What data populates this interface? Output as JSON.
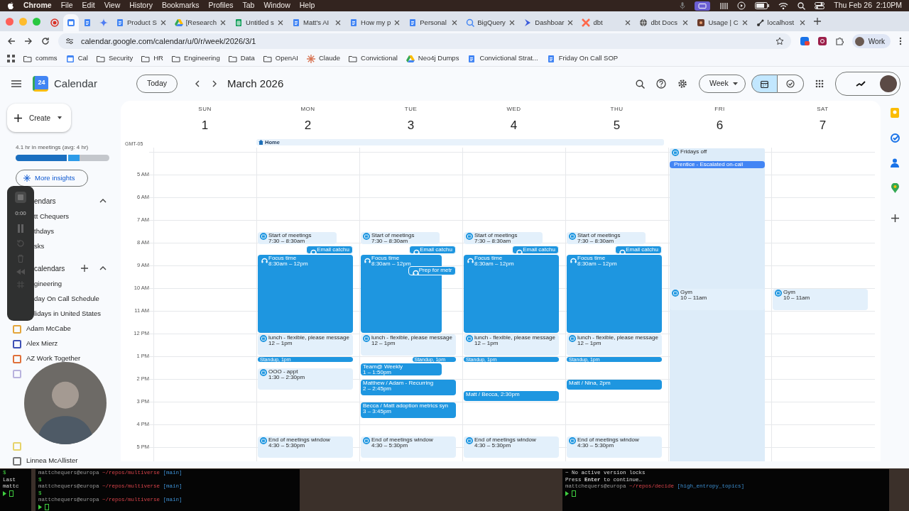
{
  "menu_bar": {
    "menus": [
      "Chrome",
      "File",
      "Edit",
      "View",
      "History",
      "Bookmarks",
      "Profiles",
      "Tab",
      "Window",
      "Help"
    ],
    "clock": "Thu Feb 26  2:10PM"
  },
  "browser": {
    "tabs": [
      {
        "kind": "record",
        "selected": false
      },
      {
        "kind": "calendar",
        "selected": true
      },
      {
        "kind": "docs",
        "selected": false
      },
      {
        "kind": "gemini",
        "selected": false
      },
      {
        "kind": "docs",
        "title": "Product S",
        "selected": false
      },
      {
        "kind": "drive",
        "title": "[Research",
        "selected": false
      },
      {
        "kind": "sheets",
        "title": "Untitled s",
        "selected": false
      },
      {
        "kind": "docs",
        "title": "Matt's AI",
        "selected": false
      },
      {
        "kind": "docs",
        "title": "How my p",
        "selected": false
      },
      {
        "kind": "docs",
        "title": "Personal",
        "selected": false
      },
      {
        "kind": "bigquery",
        "title": "BigQuery",
        "selected": false
      },
      {
        "kind": "dashboard",
        "title": "Dashboar",
        "selected": false
      },
      {
        "kind": "dbt",
        "title": "dbt",
        "selected": false
      },
      {
        "kind": "globe",
        "title": "dbt Docs",
        "selected": false
      },
      {
        "kind": "usage",
        "title": "Usage | C",
        "selected": false
      },
      {
        "kind": "localhost",
        "title": "localhost",
        "selected": false
      }
    ],
    "url": "calendar.google.com/calendar/u/0/r/week/2026/3/1",
    "profile": "Work",
    "bookmarks": [
      {
        "kind": "folder",
        "label": "comms"
      },
      {
        "kind": "cal",
        "label": "Cal"
      },
      {
        "kind": "folder",
        "label": "Security"
      },
      {
        "kind": "folder",
        "label": "HR"
      },
      {
        "kind": "folder",
        "label": "Engineering"
      },
      {
        "kind": "folder",
        "label": "Data"
      },
      {
        "kind": "folder",
        "label": "OpenAI"
      },
      {
        "kind": "claude",
        "label": "Claude"
      },
      {
        "kind": "folder",
        "label": "Convictional"
      },
      {
        "kind": "drive",
        "label": "Neo4j Dumps"
      },
      {
        "kind": "docs",
        "label": "Convictional Strat..."
      },
      {
        "kind": "docs",
        "label": "Friday On Call SOP"
      }
    ]
  },
  "calendar": {
    "logo_text": "24",
    "app_name": "Calendar",
    "today": "Today",
    "month": "March 2026",
    "view": "Week",
    "task_view_selected": false,
    "sidebar": {
      "create": "Create",
      "insight_text": "4.1 hr in meetings (avg: 4 hr)",
      "insight_bar": {
        "level": 0.68
      },
      "insights_button": "More insights",
      "sections": [
        {
          "title": "endars",
          "expanded": true,
          "add": false,
          "items": [
            {
              "kind": "cut",
              "label": "tt Chequers"
            },
            {
              "kind": "cut",
              "label": "thdays"
            },
            {
              "kind": "cut",
              "label": "sks"
            }
          ]
        },
        {
          "title": "calendars",
          "expanded": true,
          "add": true,
          "items": [
            {
              "kind": "cut",
              "label": "gineering"
            },
            {
              "kind": "cut",
              "label": "day On Call Schedule"
            },
            {
              "kind": "cut",
              "label": "lidays in United States"
            },
            {
              "kind": "calendar",
              "label": "Adam McCabe",
              "checked": false,
              "color": "#e4a53a"
            },
            {
              "kind": "calendar",
              "label": "Alex Mierz",
              "checked": false,
              "color": "#3f51b5"
            },
            {
              "kind": "calendar",
              "label": "AZ Work Together",
              "checked": false,
              "color": "#e0703a"
            },
            {
              "kind": "calendar",
              "checked": false,
              "color": "#b9b3de"
            },
            {
              "kind": "calendar",
              "checked": false,
              "color": "#e6d36a"
            },
            {
              "kind": "calendar",
              "label": "Linnea McAllister",
              "checked": false,
              "color": "#757575"
            }
          ]
        }
      ]
    },
    "timezone": "GMT-05",
    "all_day": "Home",
    "hours": [
      "5 AM",
      "6 AM",
      "7 AM",
      "8 AM",
      "9 AM",
      "10 AM",
      "11 AM",
      "12 PM",
      "1 PM",
      "2 PM",
      "3 PM",
      "4 PM",
      "5 PM"
    ],
    "days": [
      {
        "dow": "SUN",
        "date": "1"
      },
      {
        "dow": "MON",
        "date": "2",
        "events": [
          {
            "kind": "block",
            "title": "Start of meetings",
            "time": "7:30 – 8:30am"
          },
          {
            "kind": "chip",
            "title": "Email catchu"
          },
          {
            "kind": "focus",
            "title": "Focus time",
            "time": "8:30am – 12pm"
          },
          {
            "kind": "block",
            "title": "lunch - flexible, please message",
            "time": "12 – 1pm"
          },
          {
            "kind": "bar",
            "title": "Standup, 1pm"
          },
          {
            "kind": "block",
            "title": "OOO - appt",
            "time": "1:30 – 2:30pm"
          },
          {
            "kind": "block",
            "title": "End of meetings window",
            "time": "4:30 – 5:30pm"
          }
        ]
      },
      {
        "dow": "TUE",
        "date": "3",
        "events": [
          {
            "kind": "block",
            "title": "Start of meetings",
            "time": "7:30 – 8:30am"
          },
          {
            "kind": "chip",
            "title": "Email catchu"
          },
          {
            "kind": "focus",
            "title": "Focus time",
            "time": "8:30am – 12pm"
          },
          {
            "kind": "chip",
            "title": "Prep for metr"
          },
          {
            "kind": "block",
            "title": "lunch - flexible, please message",
            "time": "12 – 1pm"
          },
          {
            "kind": "meeting",
            "title": "Team@ Weekly",
            "time": "1 – 1:50pm"
          },
          {
            "kind": "bar",
            "title": "Standup, 1pm"
          },
          {
            "kind": "meeting",
            "title": "Matthew / Adam - Recurring",
            "time": "2 – 2:45pm"
          },
          {
            "kind": "meeting",
            "title": "Becca / Matt adoption metrics syn",
            "time": "3 – 3:45pm"
          },
          {
            "kind": "block",
            "title": "End of meetings window",
            "time": "4:30 – 5:30pm"
          }
        ]
      },
      {
        "dow": "WED",
        "date": "4",
        "events": [
          {
            "kind": "block",
            "title": "Start of meetings",
            "time": "7:30 – 8:30am"
          },
          {
            "kind": "chip",
            "title": "Email catchu"
          },
          {
            "kind": "focus",
            "title": "Focus time",
            "time": "8:30am – 12pm"
          },
          {
            "kind": "block",
            "title": "lunch - flexible, please message",
            "time": "12 – 1pm"
          },
          {
            "kind": "bar",
            "title": "Standup, 1pm"
          },
          {
            "kind": "meeting",
            "title": "Matt / Becca, 2:30pm"
          },
          {
            "kind": "block",
            "title": "End of meetings window",
            "time": "4:30 – 5:30pm"
          }
        ]
      },
      {
        "dow": "THU",
        "date": "5",
        "events": [
          {
            "kind": "block",
            "title": "Start of meetings",
            "time": "7:30 – 8:30am"
          },
          {
            "kind": "chip",
            "title": "Email catchu"
          },
          {
            "kind": "focus",
            "title": "Focus time",
            "time": "8:30am – 12pm"
          },
          {
            "kind": "block",
            "title": "lunch - flexible, please message",
            "time": "12 – 1pm"
          },
          {
            "kind": "bar",
            "title": "Standup, 1pm"
          },
          {
            "kind": "meeting",
            "title": "Matt / Nina, 2pm"
          },
          {
            "kind": "block",
            "title": "End of meetings window",
            "time": "4:30 – 5:30pm"
          }
        ]
      },
      {
        "dow": "FRI",
        "date": "6",
        "events": [
          {
            "kind": "dayoff",
            "title": "Fridays off"
          },
          {
            "kind": "oncall",
            "title": "Prentice - Escalated on-call"
          },
          {
            "kind": "block",
            "title": "Gym",
            "time": "10 – 11am"
          }
        ]
      },
      {
        "dow": "SAT",
        "date": "7",
        "events": [
          {
            "kind": "block",
            "title": "Gym",
            "time": "10 – 11am"
          }
        ]
      }
    ]
  },
  "recorder": {
    "time": "0:00"
  },
  "terminals": [
    {
      "lines": [
        {
          "kind": "dollar",
          "text": "$"
        },
        {
          "kind": "text",
          "text": "Last"
        },
        {
          "kind": "text",
          "text": "mattc"
        },
        {
          "kind": "cursor"
        }
      ]
    },
    {
      "lines": [
        {
          "kind": "prompt",
          "user": "mattchequers@europa",
          "path": "~/repos/multiverse",
          "branch": "[main]"
        },
        {
          "kind": "dollar",
          "text": "$"
        },
        {
          "kind": "prompt",
          "user": "mattchequers@europa",
          "path": "~/repos/multiverse",
          "branch": "[main]"
        },
        {
          "kind": "dollar",
          "text": "$"
        },
        {
          "kind": "prompt",
          "user": "mattchequers@europa",
          "path": "~/repos/multiverse",
          "branch": "[main]"
        },
        {
          "kind": "cursor"
        }
      ]
    },
    {
      "lines": [
        {
          "kind": "text",
          "text": "~ No active version locks"
        },
        {
          "kind": "text",
          "text": "Press **Enter** to continue…"
        },
        {
          "kind": "prompt",
          "user": "mattchequers@europa",
          "path": "~/repos/decide",
          "branch": "[high_entropy_topics]"
        },
        {
          "kind": "cursor"
        }
      ]
    }
  ]
}
